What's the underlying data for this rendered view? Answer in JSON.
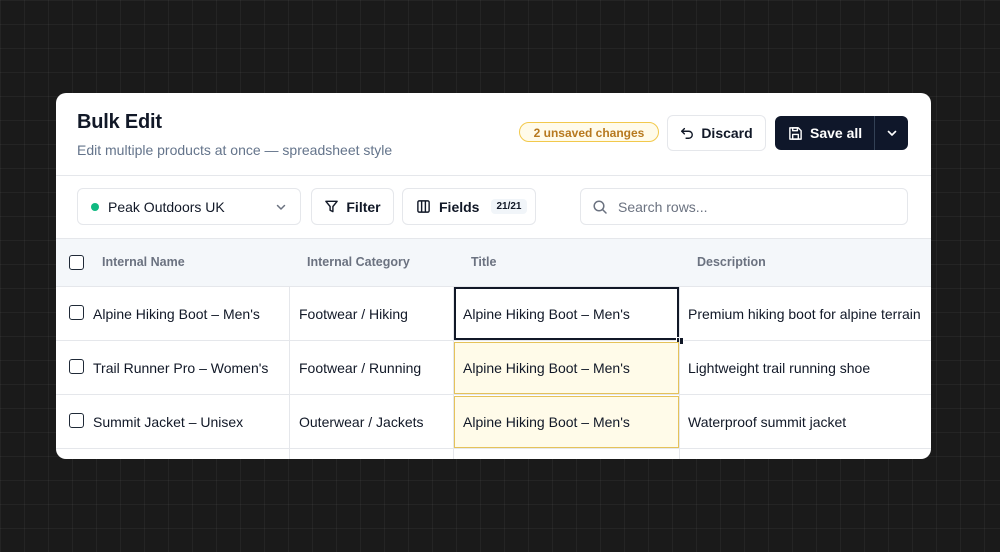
{
  "header": {
    "title": "Bulk Edit",
    "subtitle": "Edit multiple products at once — spreadsheet style",
    "unsaved_badge": "2 unsaved changes",
    "discard_label": "Discard",
    "save_label": "Save all"
  },
  "toolbar": {
    "store_name": "Peak Outdoors UK",
    "store_status_color": "#10b981",
    "filter_label": "Filter",
    "fields_label": "Fields",
    "fields_count": "21/21",
    "search_placeholder": "Search rows..."
  },
  "table": {
    "columns": [
      "Internal Name",
      "Internal Category",
      "Title",
      "Description"
    ],
    "rows": [
      {
        "internal_name": "Alpine Hiking Boot – Men's",
        "internal_category": "Footwear / Hiking",
        "title": "Alpine Hiking Boot – Men's",
        "description": "Premium hiking boot for alpine terrain"
      },
      {
        "internal_name": "Trail Runner Pro – Women's",
        "internal_category": "Footwear / Running",
        "title": "Alpine Hiking Boot – Men's",
        "description": "Lightweight trail running shoe"
      },
      {
        "internal_name": "Summit Jacket – Unisex",
        "internal_category": "Outerwear / Jackets",
        "title": "Alpine Hiking Boot – Men's",
        "description": "Waterproof summit jacket"
      }
    ]
  },
  "colors": {
    "accent_dark": "#0f172a",
    "edited_cell_bg": "#fffbe9",
    "edited_cell_border": "#e5c25a",
    "badge_text": "#b7791f"
  }
}
